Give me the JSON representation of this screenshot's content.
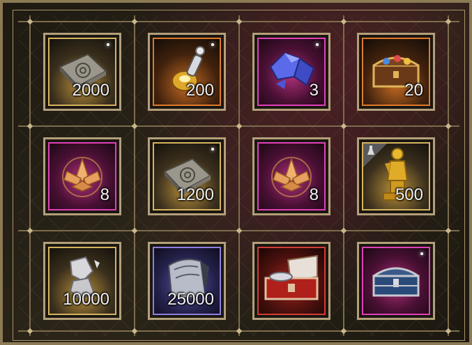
{
  "items": [
    {
      "name": "silver-plate",
      "quantity": "2000",
      "rarity": "gold"
    },
    {
      "name": "golden-potion",
      "quantity": "200",
      "rarity": "orange"
    },
    {
      "name": "blue-crystal",
      "quantity": "3",
      "rarity": "pink"
    },
    {
      "name": "treasure-chest",
      "quantity": "20",
      "rarity": "orange"
    },
    {
      "name": "golden-lotus",
      "quantity": "8",
      "rarity": "pink"
    },
    {
      "name": "silver-plate",
      "quantity": "1200",
      "rarity": "gold"
    },
    {
      "name": "golden-lotus",
      "quantity": "8",
      "rarity": "pink"
    },
    {
      "name": "golden-statue",
      "quantity": "500",
      "rarity": "gold"
    },
    {
      "name": "silver-fragments",
      "quantity": "10000",
      "rarity": "gold"
    },
    {
      "name": "silver-scroll",
      "quantity": "25000",
      "rarity": "purple"
    },
    {
      "name": "red-chest",
      "quantity": "",
      "rarity": "red"
    },
    {
      "name": "blue-chest",
      "quantity": "",
      "rarity": "pink"
    }
  ],
  "colors": {
    "frame": "#8c7a55",
    "gold": "#d6b35f",
    "orange": "#e07a2c",
    "pink": "#e040b8",
    "purple": "#8e7fe0",
    "red": "#d33c35"
  }
}
